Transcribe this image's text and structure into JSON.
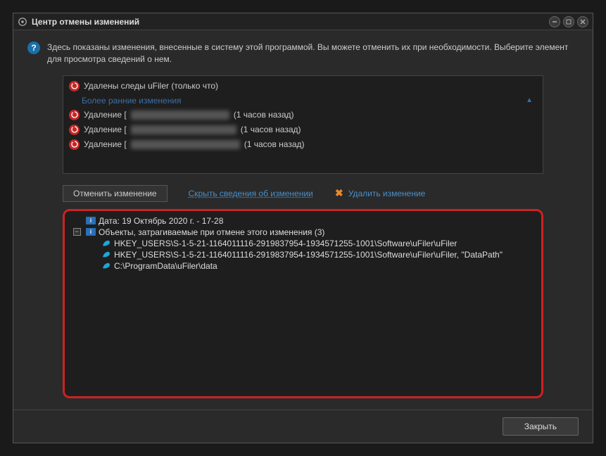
{
  "window": {
    "title": "Центр отмены изменений"
  },
  "info": {
    "text": "Здесь показаны изменения, внесенные в систему этой программой. Вы можете отменить их при необходимости. Выберите элемент для просмотра сведений о нем."
  },
  "changes": {
    "recent": {
      "label": "Удалены следы uFiler (только что)"
    },
    "earlier_header": "Более ранние изменения",
    "items": [
      {
        "prefix": "Удаление [",
        "suffix": "(1 часов назад)"
      },
      {
        "prefix": "Удаление [",
        "suffix": "(1 часов назад)"
      },
      {
        "prefix": "Удаление [",
        "suffix": "(1 часов назад)"
      }
    ]
  },
  "actions": {
    "undo": "Отменить изменение",
    "hide_details": "Скрыть сведения об изменении",
    "delete": "Удалить изменение"
  },
  "details": {
    "date_label": "Дата: 19 Октябрь 2020 г. - 17-28",
    "objects_label": "Объекты, затрагиваемые при отмене этого изменения (3)",
    "paths": [
      "HKEY_USERS\\S-1-5-21-1164011116-2919837954-1934571255-1001\\Software\\uFiler\\uFiler",
      "HKEY_USERS\\S-1-5-21-1164011116-2919837954-1934571255-1001\\Software\\uFiler\\uFiler, \"DataPath\"",
      "C:\\ProgramData\\uFiler\\data"
    ]
  },
  "footer": {
    "close": "Закрыть"
  }
}
